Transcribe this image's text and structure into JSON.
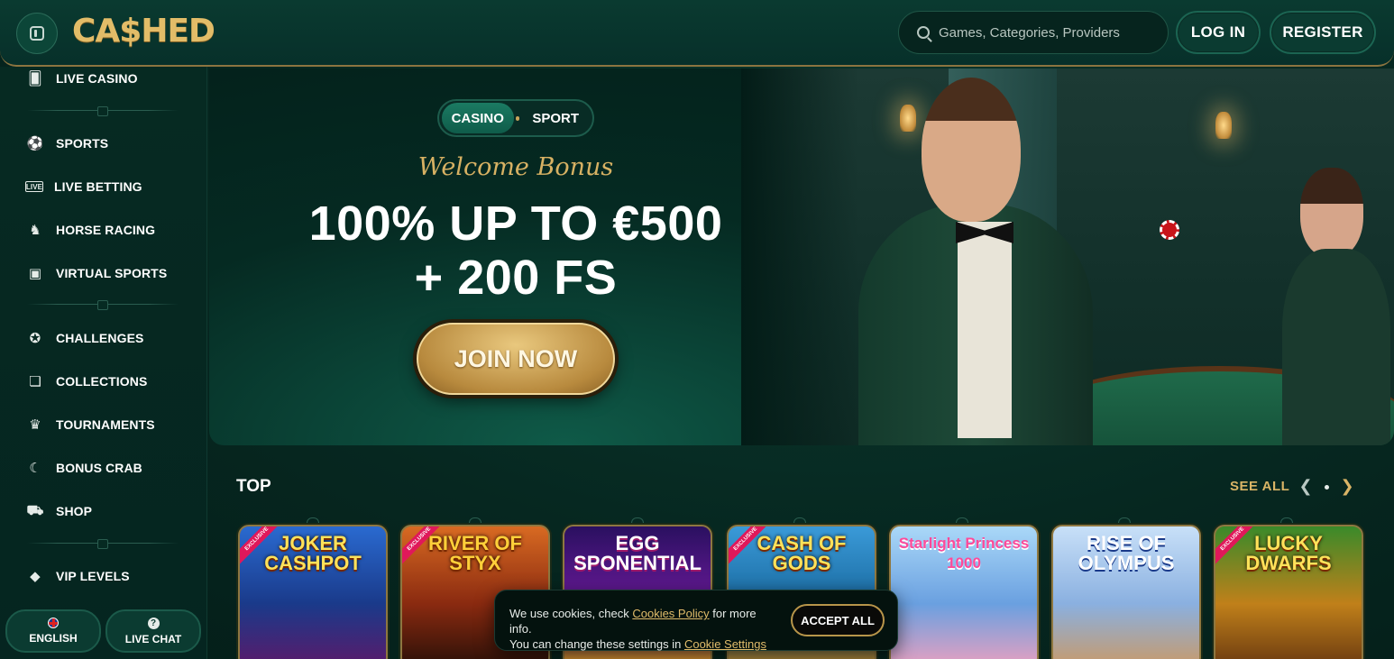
{
  "header": {
    "logo": "CA$HED",
    "search_placeholder": "Games, Categories, Providers",
    "login": "LOG IN",
    "register": "REGISTER"
  },
  "sidebar": {
    "items": [
      {
        "label": "LIVE CASINO",
        "icon": "cards-icon"
      },
      {
        "label": "SPORTS",
        "icon": "soccer-ball-icon"
      },
      {
        "label": "LIVE BETTING",
        "icon": "live-badge-icon"
      },
      {
        "label": "HORSE RACING",
        "icon": "horse-icon"
      },
      {
        "label": "VIRTUAL SPORTS",
        "icon": "virtual-screen-icon"
      },
      {
        "label": "CHALLENGES",
        "icon": "medal-icon"
      },
      {
        "label": "COLLECTIONS",
        "icon": "collection-cards-icon"
      },
      {
        "label": "TOURNAMENTS",
        "icon": "trophy-icon"
      },
      {
        "label": "BONUS CRAB",
        "icon": "crab-claw-icon"
      },
      {
        "label": "SHOP",
        "icon": "shopping-bag-icon"
      },
      {
        "label": "VIP LEVELS",
        "icon": "diamond-icon"
      }
    ],
    "language": "ENGLISH",
    "live_chat": "LIVE CHAT"
  },
  "banner": {
    "toggle": [
      "CASINO",
      "SPORT"
    ],
    "active_toggle": "CASINO",
    "welcome": "Welcome Bonus",
    "headline_line1": "100% UP TO €500",
    "headline_line2": "+ 200 FS",
    "cta": "JOIN NOW"
  },
  "top": {
    "title": "TOP",
    "see_all": "SEE ALL",
    "games": [
      {
        "name": "JOKER CASHPOT",
        "exclusive": true
      },
      {
        "name": "RIVER OF STYX",
        "exclusive": true
      },
      {
        "name": "EGG SPONENTIAL",
        "exclusive": false
      },
      {
        "name": "CASH OF GODS",
        "exclusive": true
      },
      {
        "name": "Starlight Princess 1000",
        "exclusive": false
      },
      {
        "name": "RISE OF OLYMPUS",
        "exclusive": false
      },
      {
        "name": "LUCKY DWARFS",
        "exclusive": true
      }
    ],
    "exclusive_label": "EXCLUSIVE"
  },
  "cookie": {
    "text1": "We use cookies, check",
    "link1": "Cookies Policy",
    "text2": "for more info.",
    "text3": "You can change these settings in",
    "link2": "Cookie Settings",
    "accept": "ACCEPT ALL"
  },
  "colors": {
    "background": "#062a22",
    "gold": "#d9b466",
    "accent_green": "#1b7a62"
  }
}
